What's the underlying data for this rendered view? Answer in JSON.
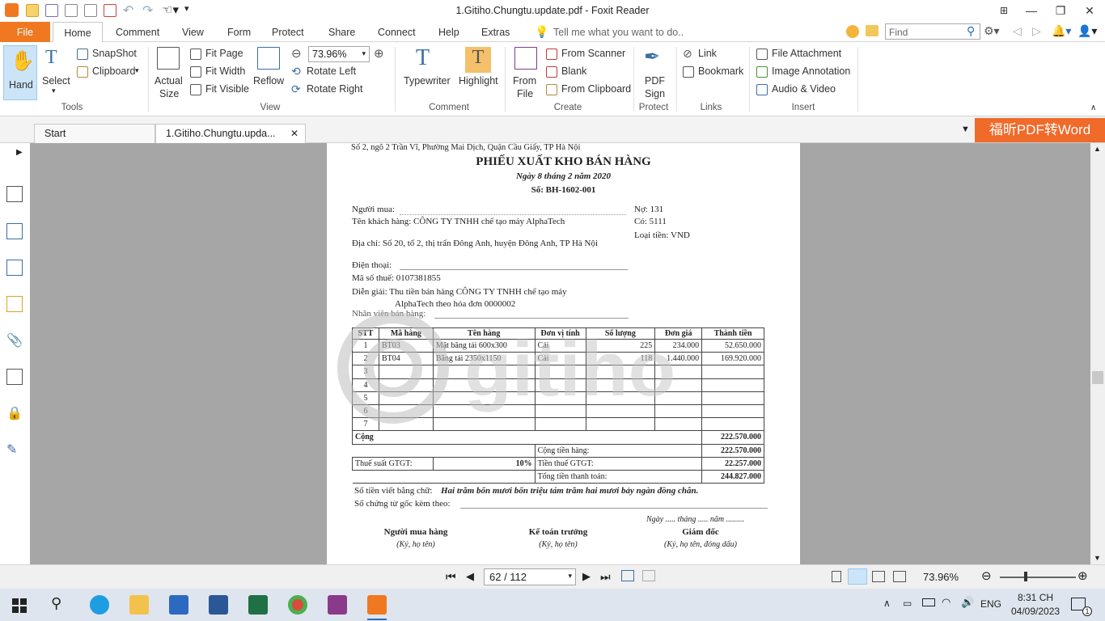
{
  "titlebar": {
    "title": "1.Gitiho.Chungtu.update.pdf - Foxit Reader"
  },
  "menu": {
    "file": "File",
    "home": "Home",
    "comment": "Comment",
    "view": "View",
    "form": "Form",
    "protect": "Protect",
    "share": "Share",
    "connect": "Connect",
    "help": "Help",
    "extras": "Extras",
    "tellme": "Tell me what you want to do..",
    "find_placeholder": "Find"
  },
  "ribbon": {
    "hand": "Hand",
    "select": "Select",
    "snapshot": "SnapShot",
    "clipboard": "Clipboard",
    "tools_group": "Tools",
    "actual": "Actual",
    "size": "Size",
    "fit_page": "Fit Page",
    "fit_width": "Fit Width",
    "fit_visible": "Fit Visible",
    "reflow": "Reflow",
    "zoom_value": "73.96%",
    "rotate_left": "Rotate Left",
    "rotate_right": "Rotate Right",
    "view_group": "View",
    "typewriter": "Typewriter",
    "highlight": "Highlight",
    "comment_group": "Comment",
    "from": "From",
    "file": "File",
    "from_scanner": "From Scanner",
    "blank": "Blank",
    "from_clipboard": "From Clipboard",
    "create_group": "Create",
    "pdf": "PDF",
    "sign": "Sign",
    "protect_group": "Protect",
    "link": "Link",
    "bookmark": "Bookmark",
    "links_group": "Links",
    "file_attachment": "File Attachment",
    "image_annotation": "Image Annotation",
    "audio_video": "Audio & Video",
    "insert_group": "Insert"
  },
  "tabs": {
    "start": "Start",
    "doc": "1.Gitiho.Chungtu.upda...",
    "promo": "福昕PDF转Word"
  },
  "doc": {
    "address": "Số 2, ngõ 2 Trần Vĩ, Phường Mai Dịch, Quận Cầu Giấy, TP Hà Nội",
    "title": "PHIẾU XUẤT KHO BÁN HÀNG",
    "date": "Ngày 8 tháng 2 năm 2020",
    "number": "Số: BH-1602-001",
    "buyer": "Người mua:",
    "customer": "Tên khách hàng: CÔNG TY TNHH chế tạo máy AlphaTech",
    "no": "Nợ: 131",
    "co": "Có: 5111",
    "currency": "Loại tiền: VND",
    "address2": "Địa chỉ: Số 20, tổ 2, thị trấn Đông Anh, huyện Đông Anh, TP Hà Nội",
    "phone": "Điện thoại:",
    "taxcode": "Mã số thuế: 0107381855",
    "desc1": "Diễn giải: Thu tiền bán hàng CÔNG TY TNHH chế tạo máy",
    "desc2": "AlphaTech theo hóa đơn 0000002",
    "staff": "Nhân viên bán hàng:",
    "headers": [
      "STT",
      "Mã hàng",
      "Tên hàng",
      "Đơn vị tính",
      "Số lượng",
      "Đơn giá",
      "Thành tiền"
    ],
    "rows": [
      [
        "1",
        "BT03",
        "Mặt băng tải 600x300",
        "Cái",
        "225",
        "234.000",
        "52.650.000"
      ],
      [
        "2",
        "BT04",
        "Băng tải 2350x1150",
        "Cái",
        "118",
        "1.440.000",
        "169.920.000"
      ],
      [
        "3",
        "",
        "",
        "",
        "",
        "",
        ""
      ],
      [
        "4",
        "",
        "",
        "",
        "",
        "",
        ""
      ],
      [
        "5",
        "",
        "",
        "",
        "",
        "",
        ""
      ],
      [
        "6",
        "",
        "",
        "",
        "",
        "",
        ""
      ],
      [
        "7",
        "",
        "",
        "",
        "",
        "",
        ""
      ]
    ],
    "total_label": "Cộng",
    "total_value": "222.570.000",
    "goods_label": "Cộng tiền hàng:",
    "goods_value": "222.570.000",
    "vat_label": "Thuế suất GTGT:",
    "vat_rate": "10%",
    "vat_amount_label": "Tiền thuế GTGT:",
    "vat_value": "22.257.000",
    "pay_label": "Tổng tiền thanh toán:",
    "pay_value": "244.827.000",
    "words_label": "Số tiền viết bằng chữ:",
    "words_value": "Hai trăm bốn mươi bốn triệu tám trăm hai mươi bảy ngàn đồng chẵn.",
    "docs_label": "Số chứng từ gốc kèm theo:",
    "sign_date": "Ngày ..... tháng ..... năm .........",
    "sig1": "Người mua hàng",
    "sig1b": "(Ký, họ tên)",
    "sig2": "Kế toán trưởng",
    "sig2b": "(Ký, họ tên)",
    "sig3": "Giám đốc",
    "sig3b": "(Ký, họ tên, đóng dấu)",
    "watermark": "gitiho"
  },
  "status": {
    "page": "62 / 112",
    "zoom": "73.96%"
  },
  "taskbar": {
    "lang": "ENG",
    "time": "8:31 CH",
    "date": "04/09/2023",
    "notif": "1"
  }
}
